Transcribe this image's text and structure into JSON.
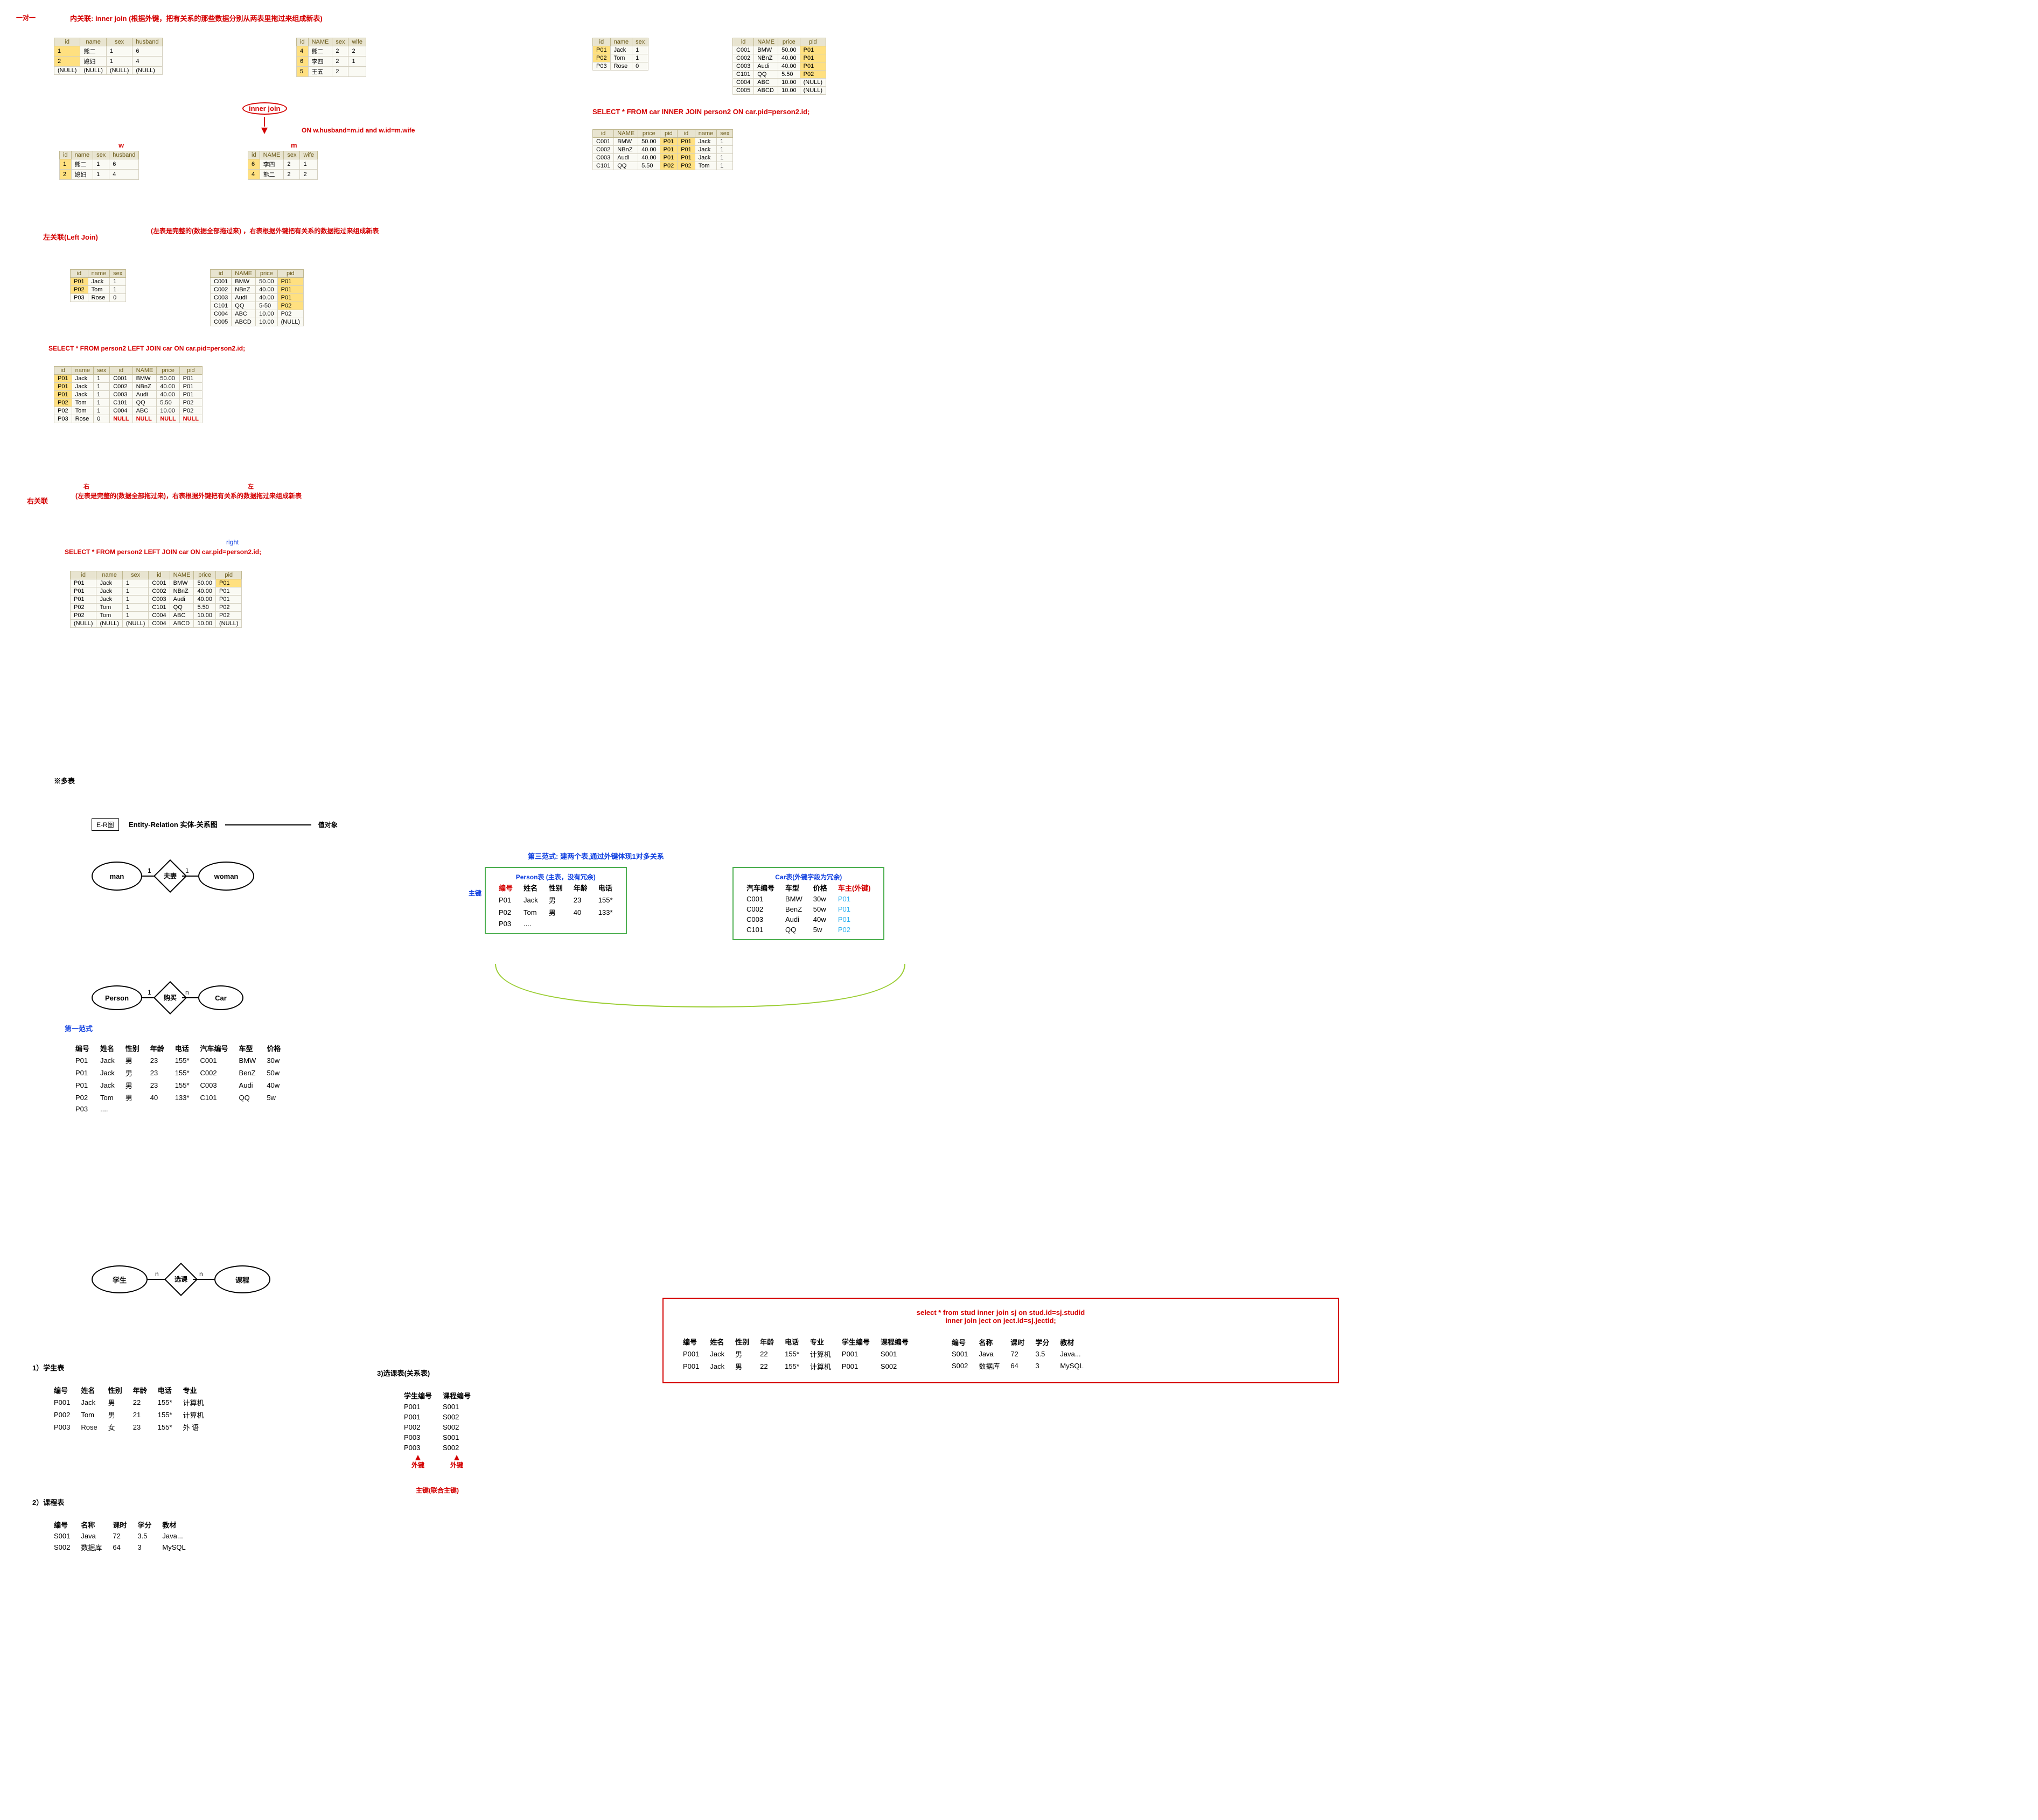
{
  "top": {
    "one_to_one": "一对一",
    "inner_title": "内关联: inner join (根据外键，把有关系的那些数据分别从两表里拖过来组成新表)",
    "inner_btn": "inner join",
    "on_text": "ON   w.husband=m.id and w.id=m.wife",
    "w": "w",
    "m": "m",
    "t_w_header": [
      "id",
      "name",
      "sex",
      "husband"
    ],
    "t_w_rows": [
      [
        "1",
        "熊二",
        "1",
        "6"
      ],
      [
        "2",
        "媳妇",
        "1",
        "4"
      ],
      [
        "(NULL)",
        "(NULL)",
        "(NULL)",
        "(NULL)"
      ]
    ],
    "t_m_header": [
      "id",
      "NAME",
      "sex",
      "wife"
    ],
    "t_m_rows": [
      [
        "4",
        "熊二",
        "2",
        "2"
      ],
      [
        "6",
        "李四",
        "2",
        "1"
      ],
      [
        "5",
        "王五",
        "2",
        ""
      ]
    ],
    "t_join_left_header": [
      "id",
      "name",
      "sex",
      "husband"
    ],
    "t_join_left_rows": [
      [
        "1",
        "熊二",
        "1",
        "6"
      ],
      [
        "2",
        "媳妇",
        "1",
        "4"
      ]
    ],
    "t_join_right_header": [
      "id",
      "NAME",
      "sex",
      "wife"
    ],
    "t_join_right_rows": [
      [
        "6",
        "李四",
        "2",
        "1"
      ],
      [
        "4",
        "熊二",
        "2",
        "2"
      ]
    ],
    "person2_header": [
      "id",
      "name",
      "sex"
    ],
    "person2_rows": [
      [
        "P01",
        "Jack",
        "1"
      ],
      [
        "P02",
        "Tom",
        "1"
      ],
      [
        "P03",
        "Rose",
        "0"
      ]
    ],
    "car_header": [
      "id",
      "NAME",
      "price",
      "pid"
    ],
    "car_rows": [
      [
        "C001",
        "BMW",
        "50.00",
        "P01"
      ],
      [
        "C002",
        "NBnZ",
        "40.00",
        "P01"
      ],
      [
        "C003",
        "Audi",
        "40.00",
        "P01"
      ],
      [
        "C101",
        "QQ",
        "5.50",
        "P02"
      ],
      [
        "C004",
        "ABC",
        "10.00",
        "(NULL)"
      ],
      [
        "C005",
        "ABCD",
        "10.00",
        "(NULL)"
      ]
    ],
    "inner_sql": "SELECT *  FROM car INNER JOIN person2 ON car.pid=person2.id;",
    "inner_res_header": [
      "id",
      "NAME",
      "price",
      "pid",
      "id",
      "name",
      "sex"
    ],
    "inner_res_rows": [
      [
        "C001",
        "BMW",
        "50.00",
        "P01",
        "P01",
        "Jack",
        "1"
      ],
      [
        "C002",
        "NBnZ",
        "40.00",
        "P01",
        "P01",
        "Jack",
        "1"
      ],
      [
        "C003",
        "Audi",
        "40.00",
        "P01",
        "P01",
        "Jack",
        "1"
      ],
      [
        "C101",
        "QQ",
        "5.50",
        "P02",
        "P02",
        "Tom",
        "1"
      ]
    ]
  },
  "left": {
    "title": "左关联(Left Join)",
    "desc": "(左表是完整的(数据全部拖过来) ，右表根据外键把有关系的数据拖过来组成新表",
    "pair_left_header": [
      "id",
      "name",
      "sex"
    ],
    "pair_left_rows": [
      [
        "P01",
        "Jack",
        "1"
      ],
      [
        "P02",
        "Tom",
        "1"
      ],
      [
        "P03",
        "Rose",
        "0"
      ]
    ],
    "pair_right_header": [
      "id",
      "NAME",
      "price",
      "pid"
    ],
    "pair_right_rows": [
      [
        "C001",
        "BMW",
        "50.00",
        "P01"
      ],
      [
        "C002",
        "NBnZ",
        "40.00",
        "P01"
      ],
      [
        "C003",
        "Audi",
        "40.00",
        "P01"
      ],
      [
        "C101",
        "QQ",
        "5-50",
        "P02"
      ],
      [
        "C004",
        "ABC",
        "10.00",
        "P02"
      ],
      [
        "C005",
        "ABCD",
        "10.00",
        "(NULL)"
      ]
    ],
    "sql": "SELECT * FROM person2 LEFT JOIN car ON car.pid=person2.id;",
    "res_header": [
      "id",
      "name",
      "sex",
      "id",
      "NAME",
      "price",
      "pid"
    ],
    "res_rows": [
      [
        "P01",
        "Jack",
        "1",
        "C001",
        "BMW",
        "50.00",
        "P01"
      ],
      [
        "P01",
        "Jack",
        "1",
        "C002",
        "NBnZ",
        "40.00",
        "P01"
      ],
      [
        "P01",
        "Jack",
        "1",
        "C003",
        "Audi",
        "40.00",
        "P01"
      ],
      [
        "P02",
        "Tom",
        "1",
        "C101",
        "QQ",
        "5.50",
        "P02"
      ],
      [
        "P02",
        "Tom",
        "1",
        "C004",
        "ABC",
        "10.00",
        "P02"
      ],
      [
        "P03",
        "Rose",
        "0",
        "NULL",
        "NULL",
        "NULL",
        "NULL"
      ]
    ]
  },
  "right": {
    "title": "右关联",
    "little_r": "右",
    "little_l": "左",
    "desc": "(左表是完整的(数据全部拖过来)，右表根据外键把有关系的数据拖过来组成新表",
    "right_lbl": "right",
    "sql": "SELECT * FROM person2 LEFT JOIN car ON car.pid=person2.id;",
    "res_header": [
      "id",
      "name",
      "sex",
      "id",
      "NAME",
      "price",
      "pid"
    ],
    "res_rows": [
      [
        "P01",
        "Jack",
        "1",
        "C001",
        "BMW",
        "50.00",
        "P01"
      ],
      [
        "P01",
        "Jack",
        "1",
        "C002",
        "NBnZ",
        "40.00",
        "P01"
      ],
      [
        "P01",
        "Jack",
        "1",
        "C003",
        "Audi",
        "40.00",
        "P01"
      ],
      [
        "P02",
        "Tom",
        "1",
        "C101",
        "QQ",
        "5.50",
        "P02"
      ],
      [
        "P02",
        "Tom",
        "1",
        "C004",
        "ABC",
        "10.00",
        "P02"
      ],
      [
        "(NULL)",
        "(NULL)",
        "(NULL)",
        "C004",
        "ABCD",
        "10.00",
        "(NULL)"
      ]
    ]
  },
  "er": {
    "section": "※多表",
    "erlabel": "E-R图",
    "erdesc": "Entity-Relation 实体-关系图",
    "valueobj": "值对象",
    "man": "man",
    "woman": "woman",
    "husband_wife": "夫妻",
    "one": "1",
    "person": "Person",
    "car": "Car",
    "buy": "购买",
    "n": "n",
    "first_nf": "第一范式",
    "first_header": [
      "编号",
      "姓名",
      "性别",
      "年龄",
      "电话",
      "汽车编号",
      "车型",
      "价格"
    ],
    "first_rows": [
      [
        "P01",
        "Jack",
        "男",
        "23",
        "155*",
        "C001",
        "BMW",
        "30w"
      ],
      [
        "P01",
        "Jack",
        "男",
        "23",
        "155*",
        "C002",
        "BenZ",
        "50w"
      ],
      [
        "P01",
        "Jack",
        "男",
        "23",
        "155*",
        "C003",
        "Audi",
        "40w"
      ],
      [
        "P02",
        "Tom",
        "男",
        "40",
        "133*",
        "C101",
        "QQ",
        "5w"
      ],
      [
        "P03",
        "....",
        "",
        "",
        "",
        "",
        "",
        ""
      ]
    ],
    "third_nf": "第三范式: 建两个表,通过外键体现1对多关系",
    "person_tbl_title": "Person表 (主表，没有冗余)",
    "pk_lbl": "主键",
    "person_header": [
      "编号",
      "姓名",
      "性别",
      "年龄",
      "电话"
    ],
    "person_rows": [
      [
        "P01",
        "Jack",
        "男",
        "23",
        "155*"
      ],
      [
        "P02",
        "Tom",
        "男",
        "40",
        "133*"
      ],
      [
        "P03",
        "....",
        "",
        "",
        ""
      ]
    ],
    "car_tbl_title": "Car表(外键字段为冗余)",
    "car_header": [
      "汽车编号",
      "车型",
      "价格",
      "车主(外键)"
    ],
    "car_rows": [
      [
        "C001",
        "BMW",
        "30w",
        "P01"
      ],
      [
        "C002",
        "BenZ",
        "50w",
        "P01"
      ],
      [
        "C003",
        "Audi",
        "40w",
        "P01"
      ],
      [
        "C101",
        "QQ",
        "5w",
        "P02"
      ]
    ]
  },
  "stud": {
    "student_lbl": "学生",
    "course_lbl": "课程",
    "choose_lbl": "选课",
    "n": "n",
    "t1_title": "1）学生表",
    "t1_header": [
      "编号",
      "姓名",
      "性别",
      "年龄",
      "电话",
      "专业"
    ],
    "t1_rows": [
      [
        "P001",
        "Jack",
        "男",
        "22",
        "155*",
        "计算机"
      ],
      [
        "P002",
        "Tom",
        "男",
        "21",
        "155*",
        "计算机"
      ],
      [
        "P003",
        "Rose",
        "女",
        "23",
        "155*",
        "外 语"
      ]
    ],
    "t2_title": "2）课程表",
    "t2_header": [
      "编号",
      "名称",
      "课时",
      "学分",
      "教材"
    ],
    "t2_rows": [
      [
        "S001",
        "Java",
        "72",
        "3.5",
        "Java..."
      ],
      [
        "S002",
        "数据库",
        "64",
        "3",
        "MySQL"
      ]
    ],
    "t3_title": "3)选课表(关系表)",
    "t3_header": [
      "学生编号",
      "课程编号"
    ],
    "t3_rows": [
      [
        "P001",
        "S001"
      ],
      [
        "P001",
        "S002"
      ],
      [
        "P002",
        "S002"
      ],
      [
        "P003",
        "S001"
      ],
      [
        "P003",
        "S002"
      ]
    ],
    "fk_lbl": "外键",
    "pk_union": "主键(联合主键)",
    "join_sql1": "select * from   stud inner join sj on   stud.id=sj.studid",
    "join_sql2": "inner join ject on ject.id=sj.jectid;",
    "res1_header": [
      "编号",
      "姓名",
      "性别",
      "年龄",
      "电话",
      "专业",
      "学生编号",
      "课程编号"
    ],
    "res1_rows": [
      [
        "P001",
        "Jack",
        "男",
        "22",
        "155*",
        "计算机",
        "P001",
        "S001"
      ],
      [
        "P001",
        "Jack",
        "男",
        "22",
        "155*",
        "计算机",
        "P001",
        "S002"
      ]
    ],
    "res2_header": [
      "编号",
      "名称",
      "课时",
      "学分",
      "教材"
    ],
    "res2_rows": [
      [
        "S001",
        "Java",
        "72",
        "3.5",
        "Java..."
      ],
      [
        "S002",
        "数据库",
        "64",
        "3",
        "MySQL"
      ]
    ]
  }
}
